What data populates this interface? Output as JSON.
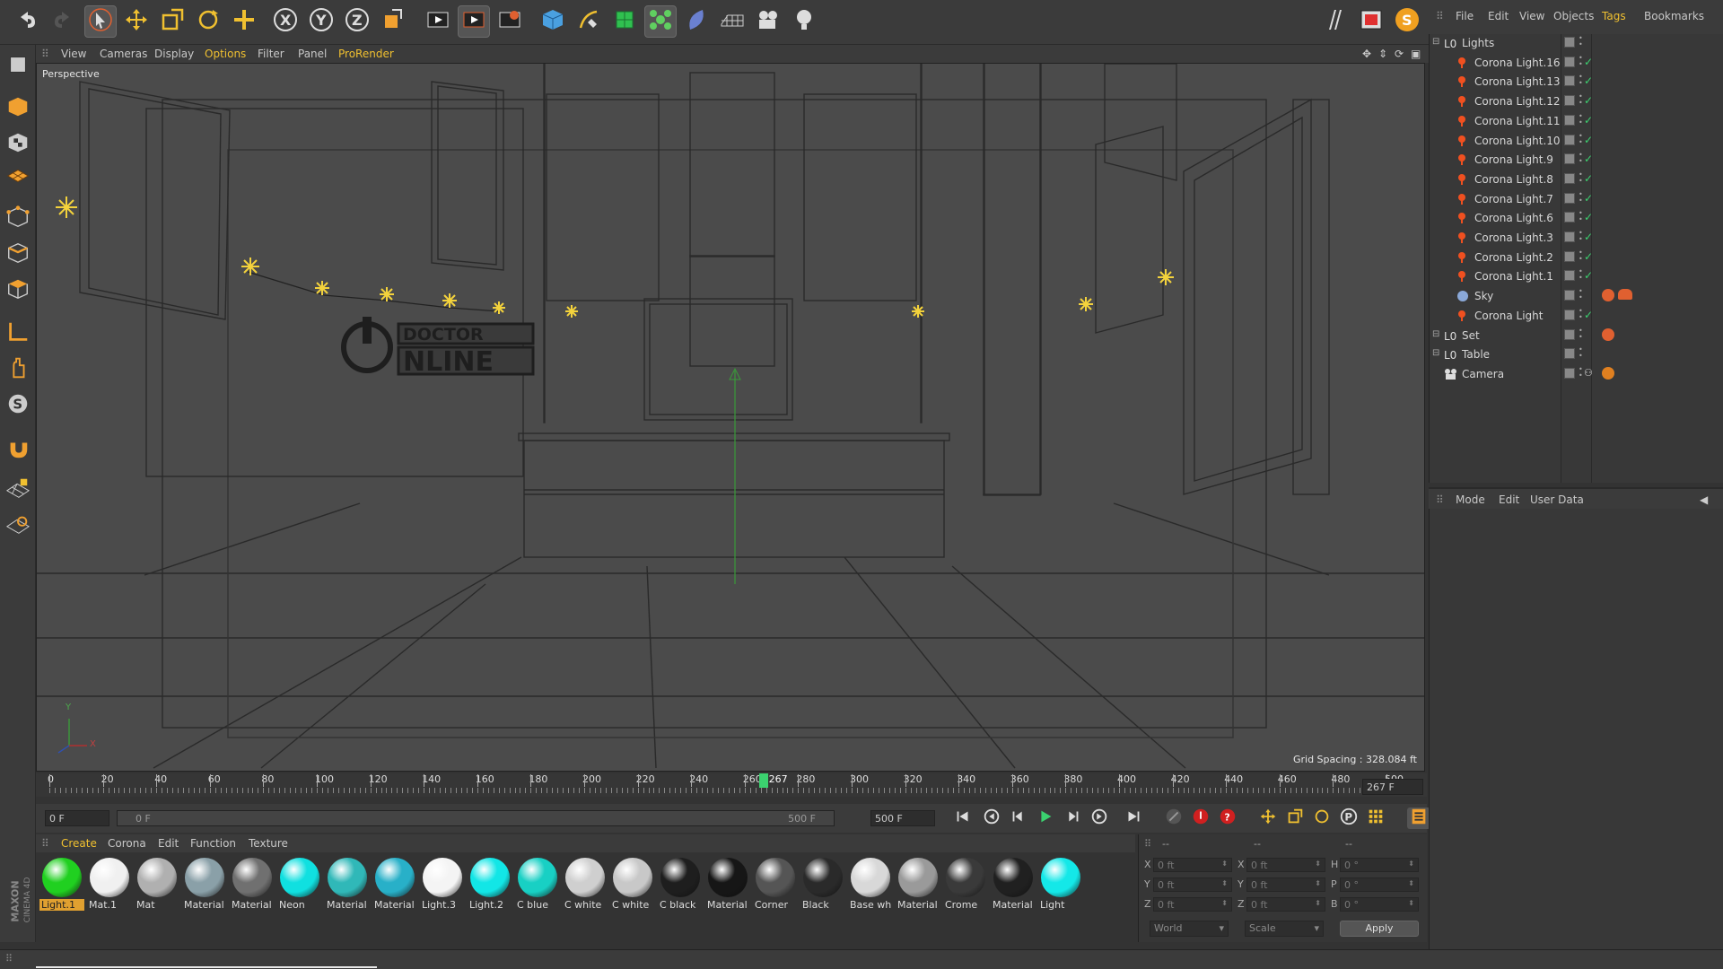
{
  "colors": {
    "accent": "#e0a030",
    "active_menu": "#f0c030",
    "timeline_marker": "#3bd16f",
    "light_sparkle": "#f3d23c"
  },
  "app": {
    "brand_top": "MAXON",
    "brand_bottom": "CINEMA 4D"
  },
  "toolbar": {
    "icons": [
      "undo-icon",
      "redo-icon",
      "select-icon",
      "move-icon",
      "scale-icon",
      "rotate-icon",
      "live-add-icon",
      "x-axis-icon",
      "y-axis-icon",
      "z-axis-icon",
      "coordinate-system-icon",
      "render-view-icon",
      "render-picture-viewer-icon",
      "render-settings-icon",
      "cube-icon",
      "pen-icon",
      "subdivision-icon",
      "cloner-icon",
      "deformer-icon",
      "floor-icon",
      "camera-icon",
      "light-icon",
      "sketch-icon",
      "picture-viewer-icon",
      "corona-logo-icon"
    ]
  },
  "viewport": {
    "menu": [
      "View",
      "Cameras",
      "Display",
      "Options",
      "Filter",
      "Panel",
      "ProRender"
    ],
    "active_menu": "Options",
    "label": "Perspective",
    "grid_spacing": "Grid Spacing : 328.084 ft",
    "axis_y": "Y",
    "axis_x": "X"
  },
  "timeline": {
    "ticks": [
      "0",
      "20",
      "40",
      "60",
      "80",
      "100",
      "120",
      "140",
      "160",
      "180",
      "200",
      "220",
      "240",
      "260",
      "280",
      "300",
      "320",
      "340",
      "360",
      "380",
      "400",
      "420",
      "440",
      "460",
      "480",
      "500"
    ],
    "current_frame": "267",
    "current_frame_field": "267 F",
    "start_field": "0 F",
    "range_start": "0 F",
    "range_end": "500 F",
    "end_field": "500 F",
    "progress": 0.534
  },
  "transport": {
    "icons": [
      "go-start-icon",
      "prev-key-icon",
      "prev-frame-icon",
      "play-icon",
      "next-frame-icon",
      "next-key-icon",
      "go-end-icon",
      "motion-path-icon",
      "record-icon",
      "autokey-icon",
      "move-key-icon",
      "scale-key-icon",
      "rotate-key-icon",
      "param-key-icon",
      "pla-key-icon",
      "timeline-icon"
    ]
  },
  "materials": {
    "menu": [
      "Create",
      "Corona",
      "Edit",
      "Function",
      "Texture"
    ],
    "active_menu": "Create",
    "items": [
      {
        "name": "Light.1",
        "color": "#20d020"
      },
      {
        "name": "Mat.1",
        "color": "#f0f0f0"
      },
      {
        "name": "Mat",
        "color": "#b0b0b0"
      },
      {
        "name": "Material",
        "color": "#8aa0a8"
      },
      {
        "name": "Material",
        "color": "#707070"
      },
      {
        "name": "Neon",
        "color": "#10e0e0"
      },
      {
        "name": "Material",
        "color": "#30b8b8"
      },
      {
        "name": "Material",
        "color": "#28b0c8"
      },
      {
        "name": "Light.3",
        "color": "#f4f4f4"
      },
      {
        "name": "Light.2",
        "color": "#12e6e6"
      },
      {
        "name": "C blue",
        "color": "#18d0c4"
      },
      {
        "name": "C white",
        "color": "#cfcfcf"
      },
      {
        "name": "C white",
        "color": "#c8c8c8"
      },
      {
        "name": "C black",
        "color": "#1e1e1e"
      },
      {
        "name": "Material",
        "color": "#161616"
      },
      {
        "name": "Corner",
        "color": "#555555"
      },
      {
        "name": "Black",
        "color": "#2a2a2a"
      },
      {
        "name": "Base wh",
        "color": "#d8d8d8"
      },
      {
        "name": "Material",
        "color": "#9a9a9a"
      },
      {
        "name": "Crome",
        "color": "#3a3a3a"
      },
      {
        "name": "Material",
        "color": "#202020"
      },
      {
        "name": "Light",
        "color": "#14e8e8"
      }
    ]
  },
  "coords": {
    "headers": [
      "--",
      "--",
      "--"
    ],
    "rows": [
      {
        "a": "X",
        "av": "0 ft",
        "b": "X",
        "bv": "0 ft",
        "c": "H",
        "cv": "0 °"
      },
      {
        "a": "Y",
        "av": "0 ft",
        "b": "Y",
        "bv": "0 ft",
        "c": "P",
        "cv": "0 °"
      },
      {
        "a": "Z",
        "av": "0 ft",
        "b": "Z",
        "bv": "0 ft",
        "c": "B",
        "cv": "0 °"
      }
    ],
    "mode": "World",
    "size_mode": "Scale",
    "apply": "Apply"
  },
  "objects": {
    "menu": [
      "File",
      "Edit",
      "View",
      "Objects",
      "Tags",
      "Bookmarks"
    ],
    "active_menu": "Tags",
    "rows": [
      {
        "name": "Lights",
        "type": "null",
        "indent": 0
      },
      {
        "name": "Corona Light.16",
        "type": "light",
        "indent": 1
      },
      {
        "name": "Corona Light.13",
        "type": "light",
        "indent": 1
      },
      {
        "name": "Corona Light.12",
        "type": "light",
        "indent": 1
      },
      {
        "name": "Corona Light.11",
        "type": "light",
        "indent": 1
      },
      {
        "name": "Corona Light.10",
        "type": "light",
        "indent": 1
      },
      {
        "name": "Corona Light.9",
        "type": "light",
        "indent": 1
      },
      {
        "name": "Corona Light.8",
        "type": "light",
        "indent": 1
      },
      {
        "name": "Corona Light.7",
        "type": "light",
        "indent": 1
      },
      {
        "name": "Corona Light.6",
        "type": "light",
        "indent": 1
      },
      {
        "name": "Corona Light.3",
        "type": "light",
        "indent": 1
      },
      {
        "name": "Corona Light.2",
        "type": "light",
        "indent": 1
      },
      {
        "name": "Corona Light.1",
        "type": "light",
        "indent": 1
      },
      {
        "name": "Sky",
        "type": "sky",
        "indent": 1
      },
      {
        "name": "Corona Light",
        "type": "light",
        "indent": 1
      },
      {
        "name": "Set",
        "type": "null",
        "indent": 0
      },
      {
        "name": "Table",
        "type": "null",
        "indent": 0
      },
      {
        "name": "Camera",
        "type": "camera",
        "indent": 0
      }
    ]
  },
  "attributes": {
    "menu": [
      "Mode",
      "Edit",
      "User Data"
    ]
  }
}
